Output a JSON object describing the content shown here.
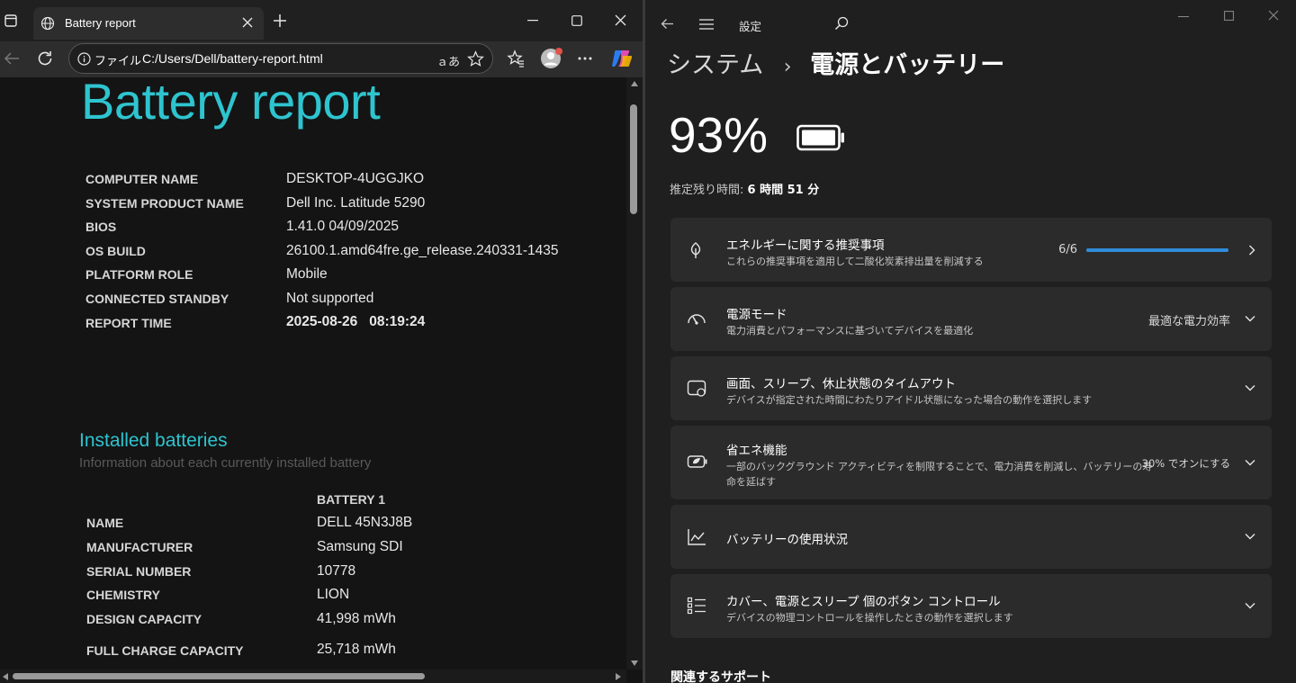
{
  "browser": {
    "tab_title": "Battery report",
    "address_label": "ファイル",
    "address_url": "C:/Users/Dell/battery-report.html"
  },
  "report": {
    "title": "Battery report",
    "system_info": [
      {
        "label": "COMPUTER NAME",
        "value": "DESKTOP-4UGGJKO"
      },
      {
        "label": "SYSTEM PRODUCT NAME",
        "value": "Dell Inc. Latitude 5290"
      },
      {
        "label": "BIOS",
        "value": "1.41.0 04/09/2025"
      },
      {
        "label": "OS BUILD",
        "value": "26100.1.amd64fre.ge_release.240331-1435"
      },
      {
        "label": "PLATFORM ROLE",
        "value": "Mobile"
      },
      {
        "label": "CONNECTED STANDBY",
        "value": "Not supported"
      },
      {
        "label": "REPORT TIME",
        "value": "2025-08-26   08:19:24"
      }
    ],
    "installed": {
      "title": "Installed batteries",
      "subtitle": "Information about each currently installed battery",
      "column": "BATTERY 1",
      "rows": [
        {
          "label": "NAME",
          "value": "DELL 45N3J8B"
        },
        {
          "label": "MANUFACTURER",
          "value": "Samsung SDI"
        },
        {
          "label": "SERIAL NUMBER",
          "value": "10778"
        },
        {
          "label": "CHEMISTRY",
          "value": "LION"
        },
        {
          "label": "DESIGN CAPACITY",
          "value": "41,998 mWh"
        },
        {
          "label": "FULL CHARGE CAPACITY",
          "value": "25,718 mWh"
        }
      ]
    }
  },
  "settings": {
    "window_title": "設定",
    "breadcrumb_parent": "システム",
    "breadcrumb_sep": "›",
    "breadcrumb_current": "電源とバッテリー",
    "battery_percent": "93%",
    "battery_level": 0.93,
    "remaining_label": "推定残り時間:",
    "remaining_value": "6 時間 51 分",
    "cards": [
      {
        "icon": "leaf-icon",
        "title": "エネルギーに関する推奨事項",
        "subtitle": "これらの推奨事項を適用して二酸化炭素排出量を削減する",
        "value": "6/6",
        "progress": 1.0
      },
      {
        "icon": "gauge-icon",
        "title": "電源モード",
        "subtitle": "電力消費とパフォーマンスに基づいてデバイスを最適化",
        "value": "最適な電力効率"
      },
      {
        "icon": "screen-sleep-icon",
        "title": "画面、スリープ、休止状態のタイムアウト",
        "subtitle": "デバイスが指定された時間にわたりアイドル状態になった場合の動作を選択します"
      },
      {
        "icon": "battery-saver-icon",
        "title": "省エネ機能",
        "subtitle": "一部のバックグラウンド アクティビティを制限することで、電力消費を削減し、バッテリーの寿",
        "subtitle2": "命を延ばす",
        "value": "30% でオンにする"
      },
      {
        "icon": "chart-line-icon",
        "title": "バッテリーの使用状況"
      },
      {
        "icon": "list-icon",
        "title": "カバー、電源とスリープ 個のボタン コントロール",
        "subtitle": "デバイスの物理コントロールを操作したときの動作を選択します"
      }
    ],
    "related_label": "関連するサポート"
  },
  "colors": {
    "accent_cyan": "#2ec4cf",
    "progress_blue": "#2f8cd8",
    "browser_bg": "#141414",
    "settings_bg": "#1f1f1f",
    "card_bg": "#2b2b2b"
  }
}
